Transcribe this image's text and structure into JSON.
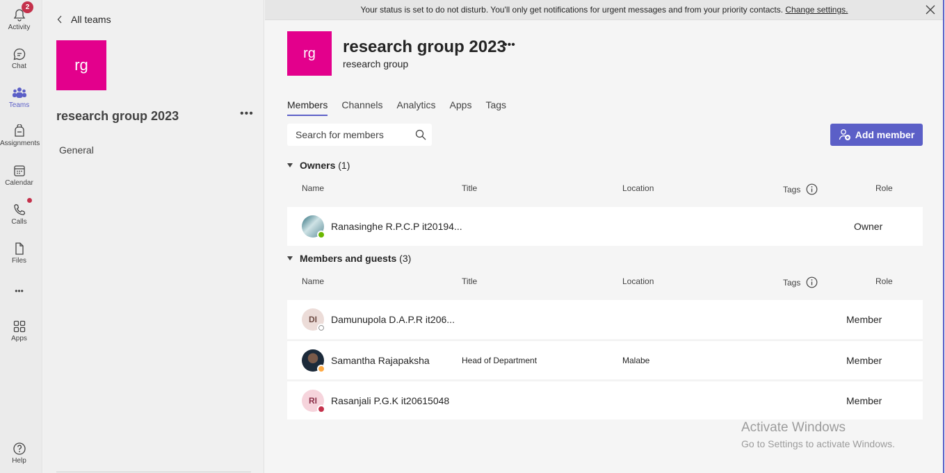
{
  "rail": {
    "activity": {
      "label": "Activity",
      "badge": "2"
    },
    "chat": {
      "label": "Chat"
    },
    "teams": {
      "label": "Teams"
    },
    "assignments": {
      "label": "Assignments"
    },
    "calendar": {
      "label": "Calendar"
    },
    "calls": {
      "label": "Calls"
    },
    "files": {
      "label": "Files"
    },
    "more": {
      "label": "•••"
    },
    "apps": {
      "label": "Apps"
    },
    "help": {
      "label": "Help"
    }
  },
  "team_pane": {
    "back_label": "All teams",
    "tile_initials": "rg",
    "team_name": "research group 2023",
    "more": "•••",
    "channels": [
      "General"
    ]
  },
  "banner": {
    "text": "Your status is set to do not disturb. You'll only get notifications for urgent messages and from your priority contacts.",
    "link": "Change settings."
  },
  "header": {
    "tile_initials": "rg",
    "title": "research group 2023",
    "more": "•••",
    "subtitle": "research group"
  },
  "tabs": [
    "Members",
    "Channels",
    "Analytics",
    "Apps",
    "Tags"
  ],
  "search": {
    "placeholder": "Search for members"
  },
  "add_button": {
    "label": "Add member"
  },
  "columns": {
    "name": "Name",
    "title": "Title",
    "location": "Location",
    "tags": "Tags",
    "role": "Role"
  },
  "owners": {
    "label": "Owners",
    "count": "(1)",
    "rows": [
      {
        "name": "Ranasinghe R.P.C.P it20194...",
        "title": "",
        "location": "",
        "role": "Owner",
        "initials": "",
        "presence": "available"
      }
    ]
  },
  "members": {
    "label": "Members and guests",
    "count": "(3)",
    "rows": [
      {
        "name": "Damunupola D.A.P.R it206...",
        "title": "",
        "location": "",
        "role": "Member",
        "initials": "DI",
        "presence": "offline"
      },
      {
        "name": "Samantha Rajapaksha",
        "title": "Head of Department",
        "location": "Malabe",
        "role": "Member",
        "initials": "",
        "presence": "away"
      },
      {
        "name": "Rasanjali P.G.K it20615048",
        "title": "",
        "location": "",
        "role": "Member",
        "initials": "RI",
        "presence": "dnd"
      }
    ]
  },
  "watermark": {
    "line1": "Activate Windows",
    "line2": "Go to Settings to activate Windows."
  },
  "colors": {
    "accent": "#5b5fc7",
    "team_tile": "#e3008c",
    "badge": "#c4314b",
    "available": "#6bb700",
    "away": "#ffaa44",
    "dnd": "#c4314b"
  }
}
